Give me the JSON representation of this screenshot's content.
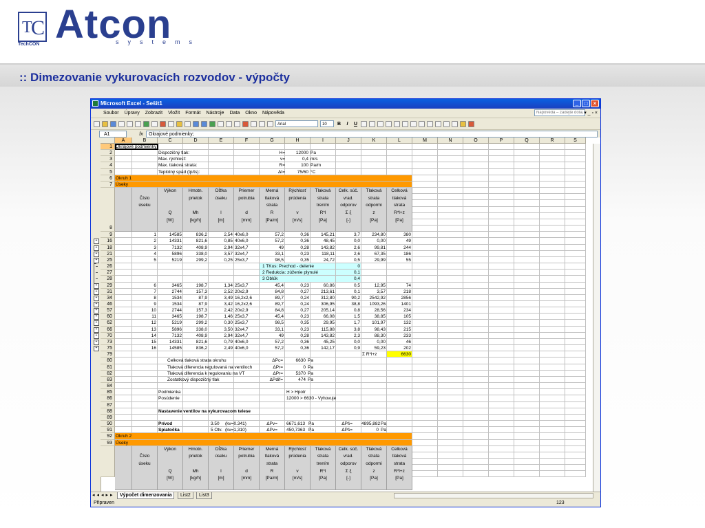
{
  "slide": {
    "logo_mark": "TC",
    "logo_sub": "TechCON",
    "logo_word": "Atcon",
    "logo_systems": "systems",
    "title": ":: Dimezovanie vykurovacích rozvodov - výpočty"
  },
  "window": {
    "title": "Microsoft Excel - Sešit1",
    "menu": [
      "Soubor",
      "Úpravy",
      "Zobrazit",
      "Vložit",
      "Formát",
      "Nástroje",
      "Data",
      "Okno",
      "Nápověda"
    ],
    "help_placeholder": "Nápověda – zadejte dotaz",
    "font": "Arial",
    "font_size": "10",
    "name_box": "A1",
    "formula": "Okrajové podmienky;",
    "columns": [
      "A",
      "B",
      "C",
      "D",
      "E",
      "F",
      "G",
      "H",
      "I",
      "J",
      "K",
      "L",
      "M",
      "N",
      "O",
      "P",
      "Q",
      "R",
      "S"
    ],
    "sheets": [
      "Výpočet dimenzovania",
      "List2",
      "List3"
    ],
    "status": "Připraven",
    "status_sum": "123"
  },
  "sheet": {
    "a1": "Okrajové podmienky;",
    "params": [
      {
        "label": "Dispozičný tlak:",
        "sym": "H=",
        "val": "12000",
        "unit": "Pa"
      },
      {
        "label": "Max. rýchlosť:",
        "sym": "v=",
        "val": "0,4",
        "unit": "m/s"
      },
      {
        "label": "Max. tlaková strata:",
        "sym": "R=",
        "val": "100",
        "unit": "Pa/m"
      },
      {
        "label": "Teplotný spád (tp/ts):",
        "sym": "Δt=",
        "val": "75/60",
        "unit": "°C"
      }
    ],
    "okruh1": "Okruh 1",
    "useky": "Úseky",
    "headers": [
      [
        "",
        "Číslo",
        "úseku",
        "",
        ""
      ],
      [
        "Výkon",
        "",
        "",
        "Q",
        "[W]"
      ],
      [
        "Hmotn.",
        "prietok",
        "",
        "Mh",
        "[kg/h]"
      ],
      [
        "Dĺžka",
        "úseku",
        "",
        "l",
        "[m]"
      ],
      [
        "Priemer",
        "potrubia",
        "",
        "d",
        "[mm]"
      ],
      [
        "Merná",
        "tlaková",
        "strata",
        "R",
        "[Pa/m]"
      ],
      [
        "Rýchlosť",
        "prúdenia",
        "",
        "v",
        "[m/s]"
      ],
      [
        "Tlaková",
        "strata",
        "trením",
        "R*l",
        "[Pa]"
      ],
      [
        "Celk. súč.",
        "vrad.",
        "odporov",
        "Σ ξ",
        "[-]"
      ],
      [
        "Tlaková",
        "strata",
        "odpormi",
        "z",
        "[Pa]"
      ],
      [
        "Celková",
        "tlaková",
        "strata",
        "R*l+z",
        "[Pa]"
      ]
    ],
    "rows": [
      {
        "n": "9",
        "v": [
          "1",
          "14585",
          "836,2",
          "2,54",
          "40x6,0",
          "57,2",
          "0,36",
          "145,21",
          "3,7",
          "234,80",
          "380"
        ]
      },
      {
        "n": "16",
        "v": [
          "2",
          "14331",
          "821,6",
          "0,85",
          "40x6,0",
          "57,2",
          "0,36",
          "48,45",
          "0,0",
          "0,00",
          "49"
        ]
      },
      {
        "n": "18",
        "v": [
          "3",
          "7132",
          "408,9",
          "2,94",
          "32x4,7",
          "49",
          "0,28",
          "143,82",
          "2,6",
          "99,81",
          "244"
        ]
      },
      {
        "n": "21",
        "v": [
          "4",
          "5896",
          "338,0",
          "3,57",
          "32x4,7",
          "33,1",
          "0,23",
          "118,11",
          "2,6",
          "67,35",
          "186"
        ]
      },
      {
        "n": "25",
        "v": [
          "5",
          "5219",
          "299,2",
          "0,25",
          "25x3,7",
          "98,5",
          "0,35",
          "24,72",
          "0,5",
          "29,99",
          "55"
        ]
      }
    ],
    "local_losses": [
      {
        "n": "26",
        "label": "1  TKus: Prechod - delenie",
        "val": "0"
      },
      {
        "n": "27",
        "label": "2  Redukcia: zúženie plynulé",
        "val": "0,1"
      },
      {
        "n": "28",
        "label": "3  Oblúk",
        "val": "0,4"
      }
    ],
    "rows2": [
      {
        "n": "29",
        "v": [
          "6",
          "3465",
          "198,7",
          "1,34",
          "25x3,7",
          "45,4",
          "0,23",
          "60,86",
          "0,5",
          "12,95",
          "74"
        ]
      },
      {
        "n": "31",
        "v": [
          "7",
          "2744",
          "157,3",
          "2,52",
          "20x2,9",
          "84,8",
          "0,27",
          "213,61",
          "0,1",
          "3,57",
          "218"
        ]
      },
      {
        "n": "34",
        "v": [
          "8",
          "1534",
          "87,9",
          "3,49",
          "16,2x2,6",
          "89,7",
          "0,24",
          "312,80",
          "90,2",
          "2542,92",
          "2856"
        ]
      },
      {
        "n": "46",
        "v": [
          "9",
          "1534",
          "87,9",
          "3,42",
          "16,2x2,6",
          "89,7",
          "0,24",
          "306,95",
          "38,8",
          "1093,26",
          "1401"
        ]
      },
      {
        "n": "57",
        "v": [
          "10",
          "2744",
          "157,3",
          "2,42",
          "20x2,9",
          "84,8",
          "0,27",
          "205,14",
          "0,8",
          "28,56",
          "234"
        ]
      },
      {
        "n": "60",
        "v": [
          "11",
          "3465",
          "198,7",
          "1,46",
          "25x3,7",
          "45,4",
          "0,23",
          "66,08",
          "1,5",
          "38,85",
          "105"
        ]
      },
      {
        "n": "62",
        "v": [
          "12",
          "5219",
          "299,2",
          "0,30",
          "25x3,7",
          "98,5",
          "0,35",
          "29,95",
          "1,7",
          "101,97",
          "132"
        ]
      },
      {
        "n": "66",
        "v": [
          "13",
          "5896",
          "338,0",
          "3,50",
          "32x4,7",
          "33,1",
          "0,23",
          "115,88",
          "3,8",
          "98,43",
          "215"
        ]
      },
      {
        "n": "70",
        "v": [
          "14",
          "7132",
          "408,9",
          "2,94",
          "32x4,7",
          "49",
          "0,28",
          "143,82",
          "2,3",
          "88,30",
          "233"
        ]
      },
      {
        "n": "73",
        "v": [
          "15",
          "14331",
          "821,6",
          "0,79",
          "40x6,0",
          "57,2",
          "0,36",
          "45,25",
          "0,0",
          "0,00",
          "46"
        ]
      },
      {
        "n": "75",
        "v": [
          "16",
          "14585",
          "836,2",
          "2,49",
          "40x6,0",
          "57,2",
          "0,36",
          "142,17",
          "0,9",
          "59,23",
          "202"
        ]
      }
    ],
    "sum_label": "Σ R*l+z",
    "sum_value": "6630",
    "summary": [
      {
        "n": "80",
        "label": "Celková tlaková strata okruhu",
        "sym": "ΔPc=",
        "val": "6630",
        "unit": "Pa"
      },
      {
        "n": "81",
        "label": "Tlaková diferencia regulovaná na ventiloch",
        "sym": "ΔPr=",
        "val": "0",
        "unit": "Pa"
      },
      {
        "n": "82",
        "label": "Tlaková diferencia k regulovaniu na VT",
        "sym": "ΔPr=",
        "val": "5370",
        "unit": "Pa"
      },
      {
        "n": "83",
        "label": "Zostatkový dispozičný tlak",
        "sym": "ΔPdif=",
        "val": "474",
        "unit": "Pa"
      }
    ],
    "podmienka_label": "Podmienka",
    "podmienka_value": "H > Hpotr",
    "posudenie_label": "Posúdenie",
    "posudenie_value": "12000 >  6630  -  Vyhovuje",
    "ventil_title": "Nastavenie ventilov na vykurovacom telese",
    "privod": {
      "label": "Prívod",
      "v1": "3.50",
      "v2": "(kv=0.341)",
      "s1": "ΔPv=",
      "val1": "6671,613",
      "u1": "Pa",
      "s2": "ΔPš=",
      "val2": "4895,882",
      "u2": "Pa"
    },
    "spiatocka": {
      "label": "Spiatočka",
      "v1": "5 Otv.",
      "v2": "(kv=1,310)",
      "s1": "ΔPv=",
      "val1": "450,7363",
      "u1": "Pa",
      "s2": "ΔPš=",
      "val2": "0",
      "u2": "Pa"
    },
    "okruh2": "Okruh 2",
    "useky2": "Úseky",
    "extra_rows": [
      "1",
      "2",
      "3",
      "4",
      "5",
      "6",
      "7",
      "8",
      "79",
      "84",
      "85",
      "86",
      "87",
      "88",
      "89",
      "90",
      "91",
      "92",
      "93"
    ]
  }
}
